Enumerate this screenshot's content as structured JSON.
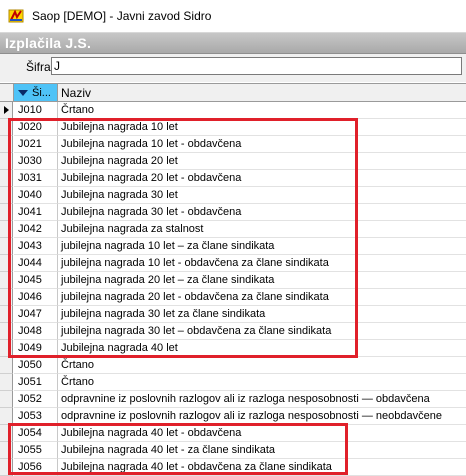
{
  "window": {
    "title": "Saop  [DEMO] - Javni zavod Sidro",
    "icon": "saop-app-icon"
  },
  "section": {
    "title": "Izplačila J.S."
  },
  "filter": {
    "label": "Šifra",
    "value": "J"
  },
  "grid": {
    "columns": [
      {
        "key": "code",
        "label": "Ši...",
        "sorted": "desc"
      },
      {
        "key": "name",
        "label": "Naziv"
      }
    ],
    "rows": [
      {
        "code": "J010",
        "name": "Črtano"
      },
      {
        "code": "J020",
        "name": "Jubilejna nagrada 10 let"
      },
      {
        "code": "J021",
        "name": "Jubilejna nagrada 10 let - obdavčena"
      },
      {
        "code": "J030",
        "name": "Jubilejna nagrada 20 let"
      },
      {
        "code": "J031",
        "name": "Jubilejna nagrada 20 let - obdavčena"
      },
      {
        "code": "J040",
        "name": "Jubilejna nagrada 30 let"
      },
      {
        "code": "J041",
        "name": "Jubilejna nagrada 30 let - obdavčena"
      },
      {
        "code": "J042",
        "name": "Jubilejna nagrada za stalnost"
      },
      {
        "code": "J043",
        "name": "jubilejna nagrada 10 let – za člane sindikata"
      },
      {
        "code": "J044",
        "name": "jubilejna nagrada 10 let - obdavčena za člane sindikata"
      },
      {
        "code": "J045",
        "name": "jubilejna nagrada 20 let – za člane sindikata"
      },
      {
        "code": "J046",
        "name": "jubilejna nagrada 20 let - obdavčena za člane sindikata"
      },
      {
        "code": "J047",
        "name": "jubilejna nagrada 30 let za člane sindikata"
      },
      {
        "code": "J048",
        "name": "jubilejna nagrada 30 let – obdavčena za člane sindikata"
      },
      {
        "code": "J049",
        "name": "Jubilejna nagrada 40 let"
      },
      {
        "code": "J050",
        "name": "Črtano"
      },
      {
        "code": "J051",
        "name": "Črtano"
      },
      {
        "code": "J052",
        "name": "odpravnine iz poslovnih razlogov ali iz razloga nesposobnosti — obdavčena"
      },
      {
        "code": "J053",
        "name": "odpravnine  iz poslovnih razlogov ali iz razloga nesposobnosti — neobdavčene"
      },
      {
        "code": "J054",
        "name": "Jubilejna nagrada 40 let - obdavčena"
      },
      {
        "code": "J055",
        "name": "Jubilejna nagrada 40 let - za člane sindikata"
      },
      {
        "code": "J056",
        "name": "Jubilejna nagrada 40 let - obdavčena za člane sindikata"
      }
    ]
  },
  "colors": {
    "highlight": "#e0202a",
    "sorted_header": "#4fc3f7",
    "section_header": "#b0b0b0"
  }
}
